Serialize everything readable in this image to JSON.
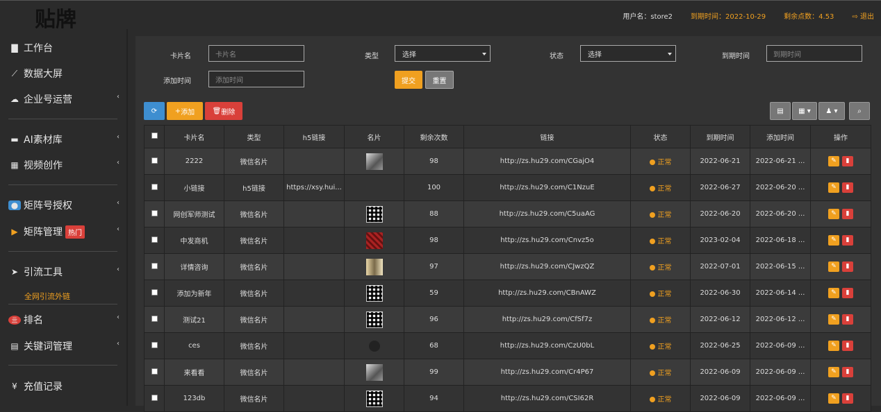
{
  "app": {
    "logo": "贴牌"
  },
  "topbar": {
    "user": "用户名：store2",
    "expire": "到期时间：2022-10-29",
    "points": "剩余点数：4.53",
    "logout": "退出"
  },
  "sidebar": {
    "items": [
      {
        "label": "工作台",
        "icon": "monitor-icon"
      },
      {
        "label": "数据大屏",
        "icon": "chart-line-icon"
      },
      {
        "label": "企业号运营",
        "icon": "cloud-icon"
      },
      {
        "label": "AI素材库",
        "icon": "folder-icon"
      },
      {
        "label": "视频创作",
        "icon": "film-icon"
      },
      {
        "label": "矩阵号授权",
        "icon": "user-icon"
      },
      {
        "label": "矩阵管理",
        "icon": "play-icon",
        "badge": "热门"
      },
      {
        "label": "引流工具",
        "icon": "send-icon"
      },
      {
        "label": "排名",
        "icon": "rank-icon"
      },
      {
        "label": "关键词管理",
        "icon": "file-icon"
      },
      {
        "label": "充值记录",
        "icon": "yen-icon"
      }
    ],
    "sub_item": "全网引流外链"
  },
  "filters": {
    "card_name_label": "卡片名",
    "card_name_placeholder": "卡片名",
    "type_label": "类型",
    "type_value": "选择",
    "status_label": "状态",
    "status_value": "选择",
    "expire_label": "到期时间",
    "expire_placeholder": "到期时间",
    "added_label": "添加时间",
    "added_placeholder": "添加时间",
    "submit": "提交",
    "reset": "重置"
  },
  "toolbar": {
    "add": "添加",
    "delete": "删除"
  },
  "table": {
    "headers": [
      "卡片名",
      "类型",
      "h5链接",
      "名片",
      "剩余次数",
      "链接",
      "状态",
      "到期时间",
      "添加时间",
      "操作"
    ],
    "rows": [
      {
        "name": "2222",
        "type": "微信名片",
        "h5": "",
        "thumb": "photo",
        "count": "98",
        "link": "http://zs.hu29.com/CGajO4",
        "status": "正常",
        "expire": "2022-06-21",
        "added": "2022-06-21 ..."
      },
      {
        "name": "小链接",
        "type": "h5链接",
        "h5": "https://xsy.hui...",
        "thumb": "",
        "count": "100",
        "link": "http://zs.hu29.com/C1NzuE",
        "status": "正常",
        "expire": "2022-06-27",
        "added": "2022-06-20 ..."
      },
      {
        "name": "网创军师测试",
        "type": "微信名片",
        "h5": "",
        "thumb": "qr",
        "count": "88",
        "link": "http://zs.hu29.com/C5uaAG",
        "status": "正常",
        "expire": "2022-06-20",
        "added": "2022-06-20 ..."
      },
      {
        "name": "中发商机",
        "type": "微信名片",
        "h5": "",
        "thumb": "red",
        "count": "98",
        "link": "http://zs.hu29.com/Cnvz5o",
        "status": "正常",
        "expire": "2023-02-04",
        "added": "2022-06-18 ..."
      },
      {
        "name": "详情咨询",
        "type": "微信名片",
        "h5": "",
        "thumb": "gold",
        "count": "97",
        "link": "http://zs.hu29.com/CJwzQZ",
        "status": "正常",
        "expire": "2022-07-01",
        "added": "2022-06-15 ..."
      },
      {
        "name": "添加为新年",
        "type": "微信名片",
        "h5": "",
        "thumb": "qr",
        "count": "59",
        "link": "http://zs.hu29.com/CBnAWZ",
        "status": "正常",
        "expire": "2022-06-30",
        "added": "2022-06-14 ..."
      },
      {
        "name": "测试21",
        "type": "微信名片",
        "h5": "",
        "thumb": "qr",
        "count": "96",
        "link": "http://zs.hu29.com/CfSf7z",
        "status": "正常",
        "expire": "2022-06-12",
        "added": "2022-06-12 ..."
      },
      {
        "name": "ces",
        "type": "微信名片",
        "h5": "",
        "thumb": "dark",
        "count": "68",
        "link": "http://zs.hu29.com/CzU0bL",
        "status": "正常",
        "expire": "2022-06-25",
        "added": "2022-06-09 ..."
      },
      {
        "name": "来看看",
        "type": "微信名片",
        "h5": "",
        "thumb": "photo",
        "count": "99",
        "link": "http://zs.hu29.com/Cr4P67",
        "status": "正常",
        "expire": "2022-06-09",
        "added": "2022-06-09 ..."
      },
      {
        "name": "123db",
        "type": "微信名片",
        "h5": "",
        "thumb": "qr",
        "count": "94",
        "link": "http://zs.hu29.com/CSI62R",
        "status": "正常",
        "expire": "2022-06-09",
        "added": "2022-06-09 ..."
      }
    ]
  }
}
